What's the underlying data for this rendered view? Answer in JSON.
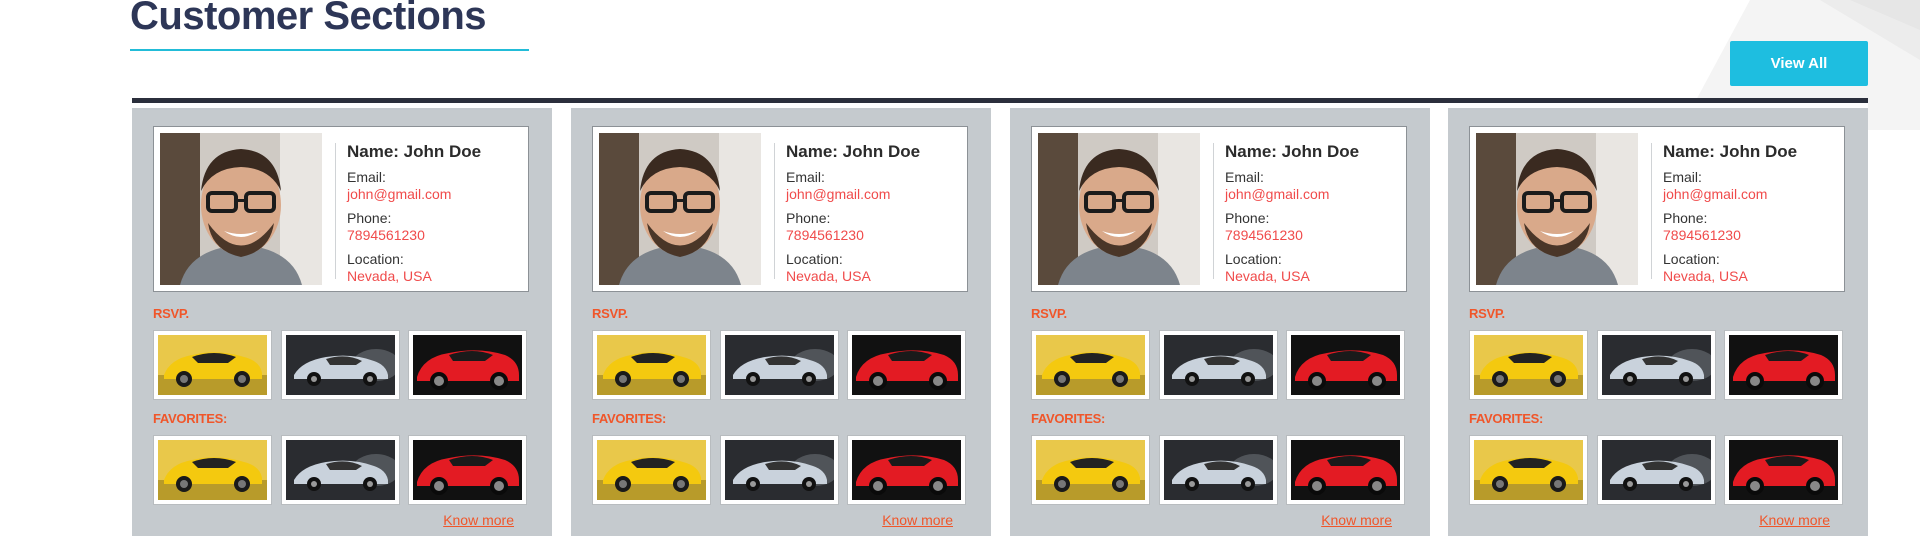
{
  "header": {
    "title": "Customer Sections",
    "view_all_label": "View All"
  },
  "colors": {
    "accent": "#1ebee0",
    "title": "#2d3657",
    "card_bg": "#c5cace",
    "link": "#f04b4b",
    "section_label": "#f0562a"
  },
  "cards": [
    {
      "name": "Name: John Doe",
      "email_label": "Email:",
      "email": "john@gmail.com",
      "phone_label": "Phone:",
      "phone": "7894561230",
      "location_label": "Location:",
      "location": "Nevada, USA",
      "rsvp_label": "RSVP.",
      "favorites_label": "FAVORITES:",
      "know_more": "Know more"
    },
    {
      "name": "Name: John Doe",
      "email_label": "Email:",
      "email": "john@gmail.com",
      "phone_label": "Phone:",
      "phone": "7894561230",
      "location_label": "Location:",
      "location": "Nevada, USA",
      "rsvp_label": "RSVP.",
      "favorites_label": "FAVORITES:",
      "know_more": "Know more"
    },
    {
      "name": "Name: John Doe",
      "email_label": "Email:",
      "email": "john@gmail.com",
      "phone_label": "Phone:",
      "phone": "7894561230",
      "location_label": "Location:",
      "location": "Nevada, USA",
      "rsvp_label": "RSVP.",
      "favorites_label": "FAVORITES:",
      "know_more": "Know more"
    },
    {
      "name": "Name: John Doe",
      "email_label": "Email:",
      "email": "john@gmail.com",
      "phone_label": "Phone:",
      "phone": "7894561230",
      "location_label": "Location:",
      "location": "Nevada, USA",
      "rsvp_label": "RSVP.",
      "favorites_label": "FAVORITES:",
      "know_more": "Know more"
    }
  ],
  "car_images": [
    {
      "icon": "yellow-sports-car-image",
      "color": "#f4c90f"
    },
    {
      "icon": "silver-sports-car-image",
      "color": "#c9d2dc"
    },
    {
      "icon": "red-sports-car-image",
      "color": "#e31b23"
    }
  ]
}
